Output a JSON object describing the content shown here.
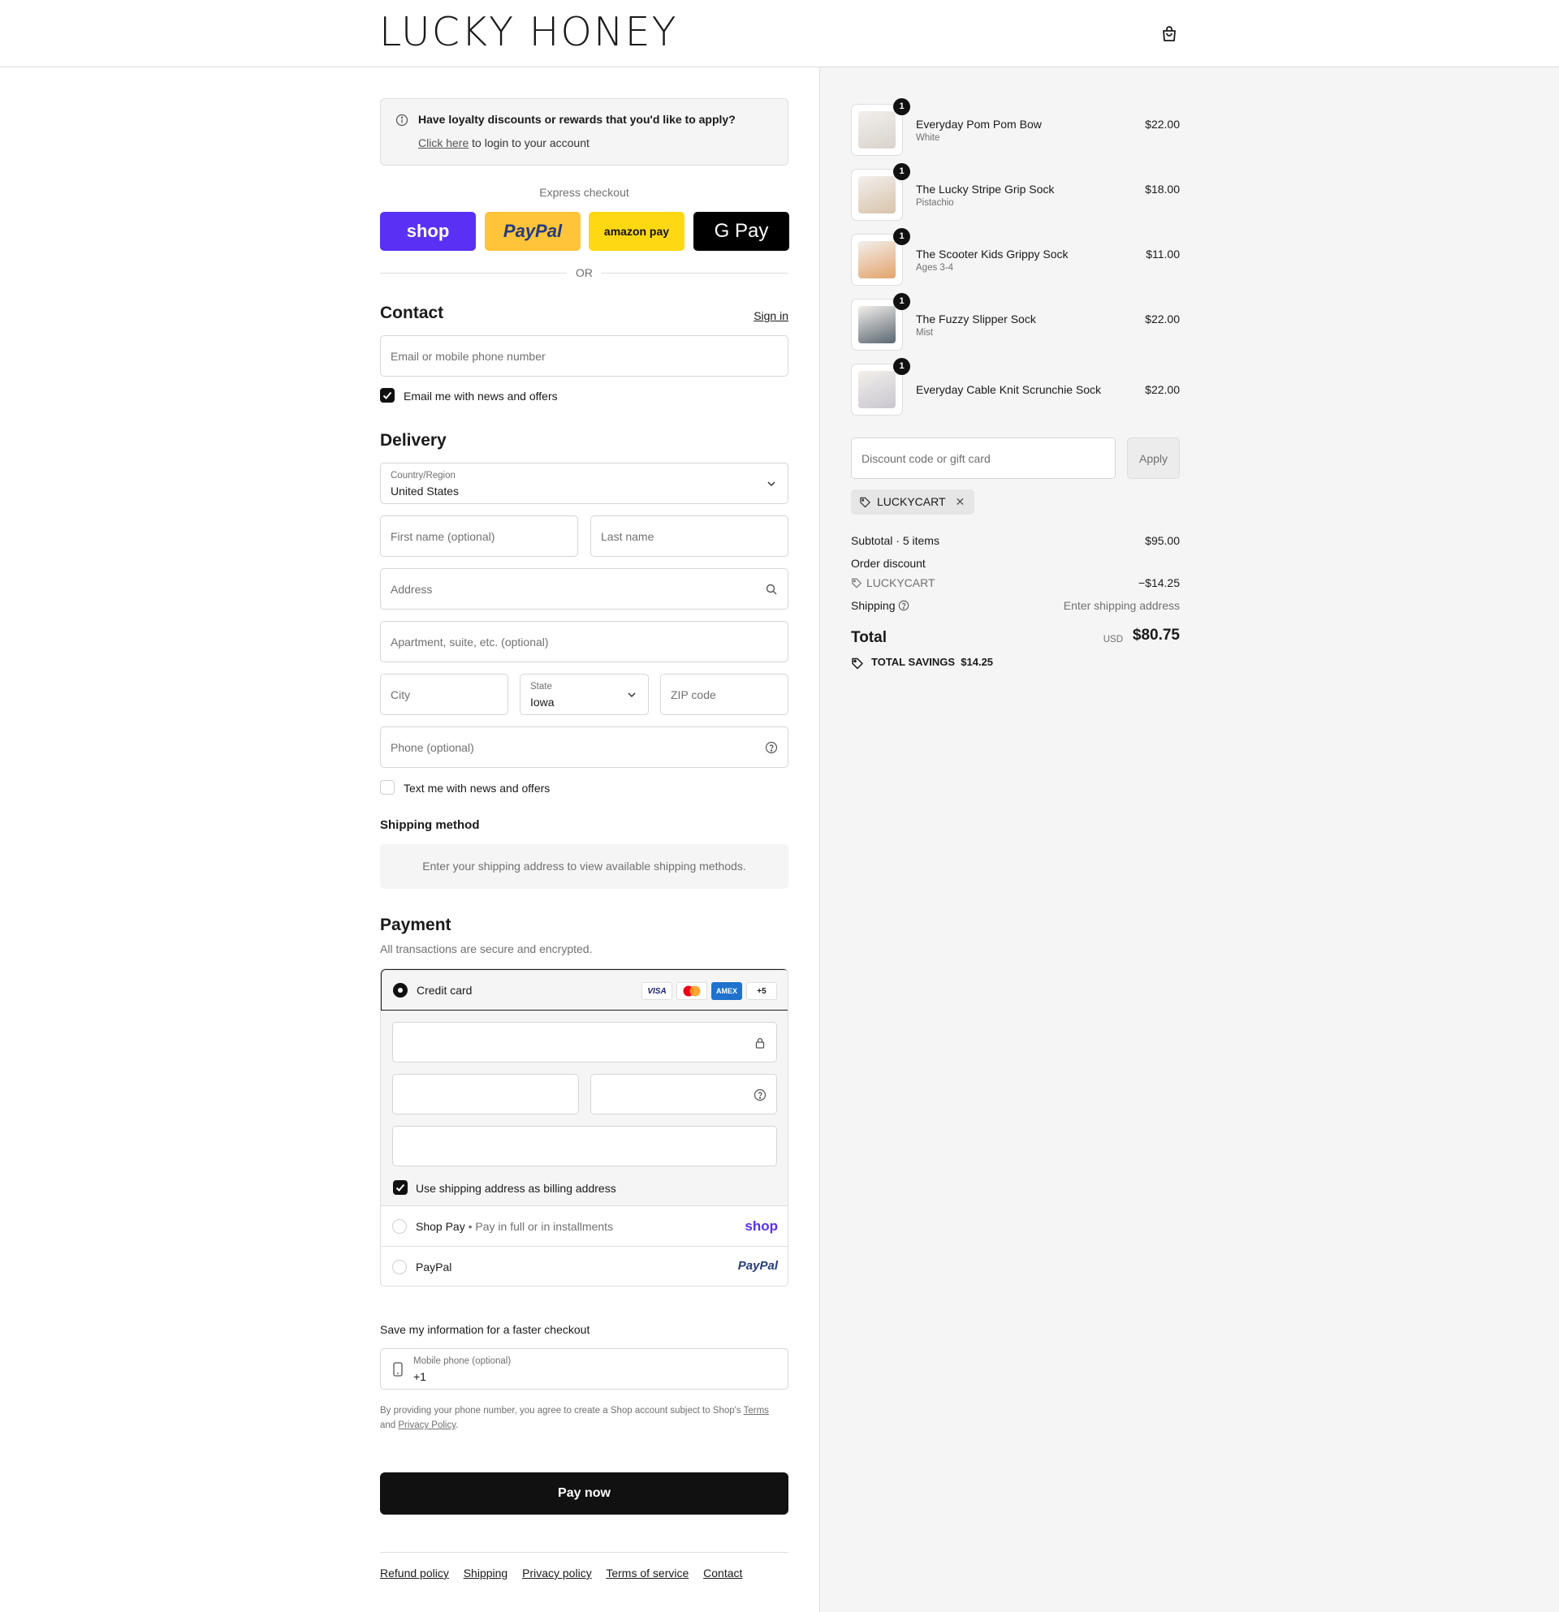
{
  "header": {
    "brand": "LUCKY HONEY",
    "cart_icon": "shopping-bag-icon"
  },
  "loyalty": {
    "title": "Have loyalty discounts or rewards that you'd like to apply?",
    "link": "Click here",
    "link_suffix": " to login to your account"
  },
  "express": {
    "label": "Express checkout",
    "buttons": {
      "shop": "shop",
      "paypal": "PayPal",
      "amazon": "amazon pay",
      "gpay": "G Pay"
    },
    "or": "OR"
  },
  "contact": {
    "title": "Contact",
    "sign_in": "Sign in",
    "email_placeholder": "Email or mobile phone number",
    "news_checkbox": "Email me with news and offers",
    "news_checked": true
  },
  "delivery": {
    "title": "Delivery",
    "country_label": "Country/Region",
    "country_value": "United States",
    "first_name_placeholder": "First name (optional)",
    "last_name_placeholder": "Last name",
    "address_placeholder": "Address",
    "apartment_placeholder": "Apartment, suite, etc. (optional)",
    "city_placeholder": "City",
    "state_label": "State",
    "state_value": "Iowa",
    "zip_placeholder": "ZIP code",
    "phone_placeholder": "Phone (optional)",
    "text_checkbox": "Text me with news and offers",
    "text_checked": false
  },
  "shipping_method": {
    "title": "Shipping method",
    "message": "Enter your shipping address to view available shipping methods."
  },
  "payment": {
    "title": "Payment",
    "subtitle": "All transactions are secure and encrypted.",
    "credit_card": "Credit card",
    "card_logos": [
      "VISA",
      "",
      "AMEX",
      "+5"
    ],
    "billing_checkbox": "Use shipping address as billing address",
    "billing_checked": true,
    "shop_pay": "Shop Pay",
    "shop_pay_note": "Pay in full or in installments",
    "shop_pay_logo": "shop",
    "paypal": "PayPal",
    "paypal_logo": "PayPal"
  },
  "save_info": {
    "title": "Save my information for a faster checkout",
    "phone_label": "Mobile phone (optional)",
    "phone_value": "+1",
    "legal_prefix": "By providing your phone number, you agree to create a Shop account subject to Shop's ",
    "terms": "Terms",
    "and": "and ",
    "privacy": "Privacy Policy",
    "period": "."
  },
  "pay_now": "Pay now",
  "footer": [
    "Refund policy",
    "Shipping",
    "Privacy policy",
    "Terms of service",
    "Contact"
  ],
  "cart": {
    "items": [
      {
        "name": "Everyday Pom Pom Bow",
        "variant": "White",
        "price": "$22.00",
        "qty": "1",
        "color": "#d9d3cc"
      },
      {
        "name": "The Lucky Stripe Grip Sock",
        "variant": "Pistachio",
        "price": "$18.00",
        "qty": "1",
        "color": "#d8c3ab"
      },
      {
        "name": "The Scooter Kids Grippy Sock",
        "variant": "Ages 3-4",
        "price": "$11.00",
        "qty": "1",
        "color": "#e3a36a"
      },
      {
        "name": "The Fuzzy Slipper Sock",
        "variant": "Mist",
        "price": "$22.00",
        "qty": "1",
        "color": "#5a6670"
      },
      {
        "name": "Everyday Cable Knit Scrunchie Sock",
        "variant": "",
        "price": "$22.00",
        "qty": "1",
        "color": "#c9c6cf"
      }
    ],
    "discount_placeholder": "Discount code or gift card",
    "apply": "Apply",
    "applied_code": "LUCKYCART",
    "subtotal_label": "Subtotal · 5 items",
    "subtotal": "$95.00",
    "order_discount_label": "Order discount",
    "discount_code": "LUCKYCART",
    "discount_amount": "−$14.25",
    "shipping_label": "Shipping",
    "shipping_value": "Enter shipping address",
    "total_label": "Total",
    "currency": "USD",
    "total": "$80.75",
    "savings": "TOTAL SAVINGS  $14.25"
  }
}
